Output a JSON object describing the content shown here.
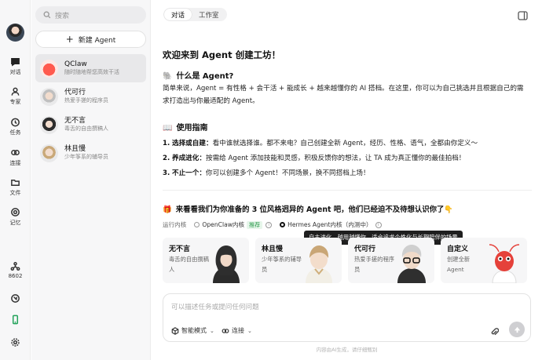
{
  "rail": {
    "items": [
      {
        "label": "对话",
        "icon": "chat-icon"
      },
      {
        "label": "专家",
        "icon": "expert-icon"
      },
      {
        "label": "任务",
        "icon": "clock-icon"
      },
      {
        "label": "连接",
        "icon": "link-icon"
      },
      {
        "label": "文件",
        "icon": "folder-icon"
      },
      {
        "label": "记忆",
        "icon": "memory-icon"
      }
    ],
    "port_label": "8602"
  },
  "list": {
    "search_placeholder": "搜索",
    "new_agent_label": "新建 Agent",
    "conversations": [
      {
        "name": "QClaw",
        "desc": "随时随地帮您高效干活"
      },
      {
        "name": "代可行",
        "desc": "热爱手搓的程序员"
      },
      {
        "name": "无不言",
        "desc": "毒舌的自由撰稿人"
      },
      {
        "name": "林且慢",
        "desc": "少年筝系的辅导员"
      }
    ]
  },
  "header": {
    "tabs": [
      "对话",
      "工作室"
    ]
  },
  "main": {
    "welcome_title": "欢迎来到 Agent 创建工坊！",
    "what_title_emoji": "🐘",
    "what_title": "什么是 Agent?",
    "what_body": "简单来说，Agent = 有性格 + 会干活 + 能成长 + 越来越懂你的 AI 搭档。在这里，你可以为自己挑选并且根据自己的需求打造出与你最适配的 Agent。",
    "guide_title_emoji": "📖",
    "guide_title": "使用指南",
    "guide_items": [
      {
        "num": "1.",
        "bold": "选择或自建：",
        "text": "看中谁就选择谁。都不来电？自己创建全新 Agent，经历、性格、语气，全都由你定义～"
      },
      {
        "num": "2.",
        "bold": "养成进化：",
        "text": "按需给 Agent 添加技能和灵感，积极反馈你的想法，让 TA 成为真正懂你的最佳拍档！"
      },
      {
        "num": "3.",
        "bold": "不止一个：",
        "text": "你可以创建多个 Agent！不同场景，换不同搭档上场！"
      }
    ],
    "intro_emoji": "🎁",
    "intro_text": "来看看我们为你准备的 3 位风格迥异的 Agent 吧，他们已经迫不及待想认识你了👇",
    "kernel_label": "运行内核",
    "kernel_options": [
      {
        "label": "OpenClaw内核",
        "tag": "推荐"
      },
      {
        "label": "Hermes Agent内核（内测中）"
      }
    ],
    "tooltip": "自主进化、越用越懂你，适合追求个性化与长期陪伴的场景",
    "cards": [
      {
        "name": "无不言",
        "desc": "毒舌的自由撰稿人"
      },
      {
        "name": "林且慢",
        "desc": "少年筝系的辅导员"
      },
      {
        "name": "代可行",
        "desc": "热爱手搓的程序员"
      },
      {
        "name": "自定义",
        "desc": "创建全新 Agent"
      }
    ]
  },
  "composer": {
    "placeholder": "可以描述任务或提问任何问题",
    "mode_label": "智能模式",
    "connect_label": "连接"
  },
  "disclaimer": "内容由AI生成，请仔细甄别"
}
